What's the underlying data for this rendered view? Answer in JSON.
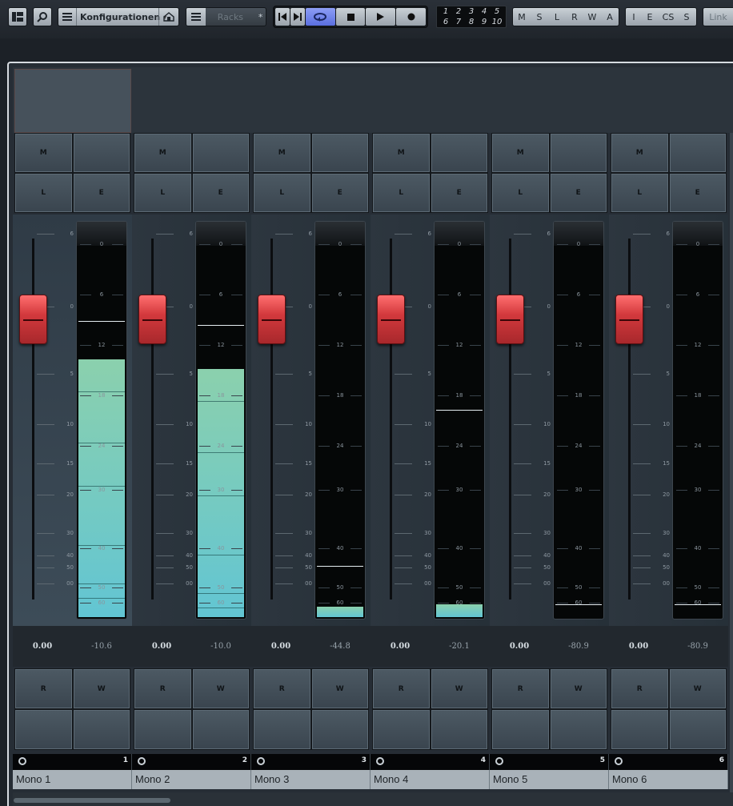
{
  "toolbar": {
    "config_label": "Konfigurationen",
    "racks_label": "Racks",
    "star_label": "*",
    "numbers_row1": [
      "1",
      "2",
      "3",
      "4",
      "5"
    ],
    "numbers_row2": [
      "6",
      "7",
      "8",
      "9",
      "10"
    ],
    "msl_group": [
      "M",
      "S",
      "L",
      "R",
      "W",
      "A"
    ],
    "iecs_group": [
      "I",
      "E",
      "CS",
      "S"
    ],
    "link_label": "Link",
    "transport_active": "cycle"
  },
  "buttons": {
    "mute": "M",
    "solo_l": "L",
    "edit": "E",
    "read": "R",
    "write": "W"
  },
  "fader_scale": [
    "6",
    "0",
    "5",
    "10",
    "15",
    "20",
    "30",
    "40",
    "50",
    "00"
  ],
  "meter_scale": [
    "0",
    "6",
    "12",
    "18",
    "24",
    "30",
    "40",
    "50",
    "60"
  ],
  "channels": [
    {
      "name": "Mono 1",
      "number": "1",
      "volume": "0.00",
      "peak": "-10.6",
      "selected": true
    },
    {
      "name": "Mono 2",
      "number": "2",
      "volume": "0.00",
      "peak": "-10.0",
      "selected": false
    },
    {
      "name": "Mono 3",
      "number": "3",
      "volume": "0.00",
      "peak": "-44.8",
      "selected": false
    },
    {
      "name": "Mono 4",
      "number": "4",
      "volume": "0.00",
      "peak": "-20.1",
      "selected": false
    },
    {
      "name": "Mono 5",
      "number": "5",
      "volume": "0.00",
      "peak": "-80.9",
      "selected": false
    },
    {
      "name": "Mono 6",
      "number": "6",
      "volume": "0.00",
      "peak": "-80.9",
      "selected": false
    }
  ],
  "colors": {
    "fader": "#d3393d",
    "meter_top": "#8bd0ad",
    "meter_bottom": "#62c5d3",
    "cycle_active": "#6a7ef0"
  }
}
